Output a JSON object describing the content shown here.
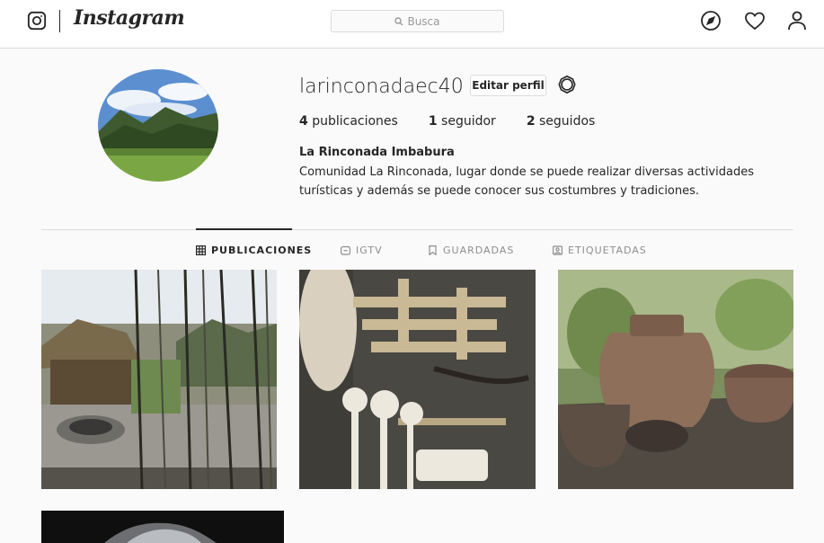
{
  "nav": {
    "brand": "Instagram",
    "search_placeholder": "Busca"
  },
  "profile": {
    "username": "larinconadaec40",
    "edit_label": "Editar perfil",
    "stats": [
      {
        "count": "4",
        "label": "publicaciones"
      },
      {
        "count": "1",
        "label": "seguidor"
      },
      {
        "count": "2",
        "label": "seguidos"
      }
    ],
    "full_name": "La Rinconada Imbabura",
    "bio": "Comunidad La Rinconada, lugar donde se puede realizar diversas actividades turísticas y además se puede conocer sus costumbres y tradiciones."
  },
  "tabs": [
    {
      "label": "PUBLICACIONES",
      "icon": "grid-icon",
      "active": true
    },
    {
      "label": "IGTV",
      "icon": "igtv-icon",
      "active": false
    },
    {
      "label": "GUARDADAS",
      "icon": "bookmark-icon",
      "active": false
    },
    {
      "label": "ETIQUETADAS",
      "icon": "tagged-icon",
      "active": false
    }
  ],
  "posts": [
    {
      "subject": "thatched huts with fire pit"
    },
    {
      "subject": "wooden spoons and crafts"
    },
    {
      "subject": "clay pots on table"
    },
    {
      "subject": "waterfall in dark"
    }
  ]
}
